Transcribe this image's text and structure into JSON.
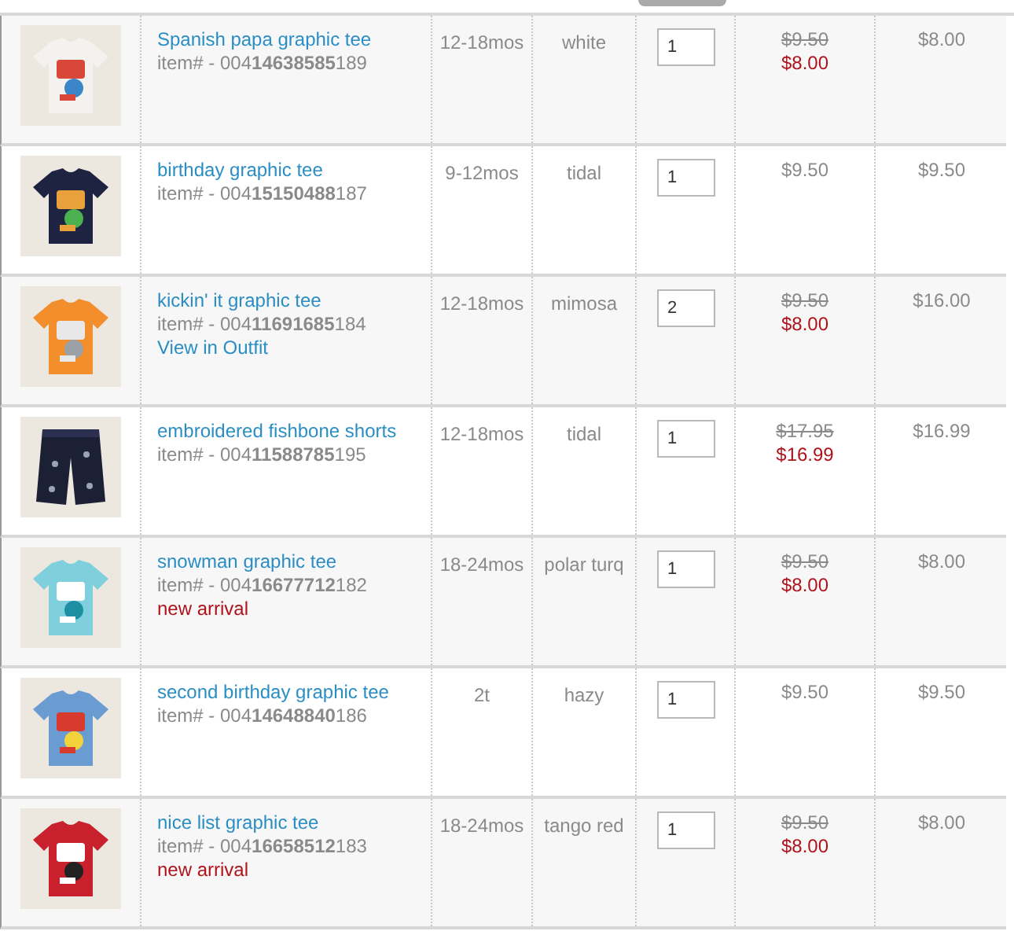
{
  "cart": {
    "rows": [
      {
        "name": "Spanish papa graphic tee",
        "item": "item# - 004**14638585**189",
        "size": "12-18mos",
        "shade": "white",
        "quantity": "1",
        "was": "$9.50",
        "price": "$8.00",
        "total": "$8.00"
      },
      {
        "name": "birthday graphic tee",
        "item": "item# - 004**15150488**187",
        "size": "9-12mos",
        "shade": "tidal",
        "quantity": "1",
        "price": "$9.50",
        "total": "$9.50"
      },
      {
        "name": "kickin' it graphic tee",
        "item": "item# - 004**11691685**184",
        "note": {
          "kind": "link",
          "text": "View in Outfit"
        },
        "size": "12-18mos",
        "shade": "mimosa",
        "quantity": "2",
        "was": "$9.50",
        "price": "$8.00",
        "total": "$16.00"
      },
      {
        "name": "embroidered fishbone shorts",
        "item": "item# - 004**11588785**195",
        "size": "12-18mos",
        "shade": "tidal",
        "quantity": "1",
        "was": "$17.95",
        "price": "$16.99",
        "total": "$16.99"
      },
      {
        "name": "snowman graphic tee",
        "item": "item# - 004**16677712**182",
        "note": {
          "kind": "new",
          "text": "new arrival"
        },
        "size": "18-24mos",
        "shade": "polar turq",
        "quantity": "1",
        "was": "$9.50",
        "price": "$8.00",
        "total": "$8.00"
      },
      {
        "name": "second birthday graphic tee",
        "item": "item# - 004**14648840**186",
        "size": "2t",
        "shade": "hazy",
        "quantity": "1",
        "price": "$9.50",
        "total": "$9.50"
      },
      {
        "name": "nice list graphic tee",
        "item": "item# - 004**16658512**183",
        "note": {
          "kind": "new",
          "text": "new arrival"
        },
        "size": "18-24mos",
        "shade": "tango red",
        "quantity": "1",
        "was": "$9.50",
        "price": "$8.00",
        "total": "$8.00"
      }
    ]
  }
}
